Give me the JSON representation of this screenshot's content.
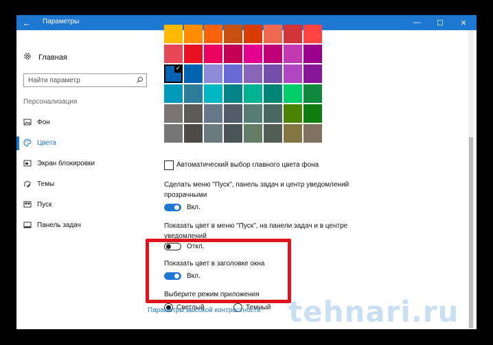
{
  "titlebar": {
    "title": "Параметры",
    "back_icon": "←",
    "min_icon": "—",
    "max_icon": "☐",
    "close_icon": "✕"
  },
  "sidebar": {
    "home": "Главная",
    "search_placeholder": "Найти параметр",
    "section": "Персонализация",
    "items": [
      {
        "label": "Фон",
        "icon": "image-icon"
      },
      {
        "label": "Цвета",
        "icon": "palette-icon",
        "active": true
      },
      {
        "label": "Экран блокировки",
        "icon": "lockscreen-icon"
      },
      {
        "label": "Темы",
        "icon": "themes-icon"
      },
      {
        "label": "Пуск",
        "icon": "start-icon"
      },
      {
        "label": "Панель задач",
        "icon": "taskbar-icon"
      }
    ]
  },
  "colors": {
    "rows": [
      [
        "#ffb900",
        "#ff8c00",
        "#f7630c",
        "#ca5010",
        "#da3b01",
        "#ef6950",
        "#d13438",
        "#ff4343"
      ],
      [
        "#e74856",
        "#e81123",
        "#ea005e",
        "#c30052",
        "#e3008c",
        "#bf0077",
        "#c239b3",
        "#9a0089"
      ],
      [
        "#0063b1",
        "#0063b1",
        "#8e8cd8",
        "#6b69d6",
        "#8764b8",
        "#744da9",
        "#b146c2",
        "#881798"
      ],
      [
        "#0099bc",
        "#2d7d9a",
        "#00b7c3",
        "#038387",
        "#00b294",
        "#018574",
        "#00cc6a",
        "#10893e"
      ],
      [
        "#7a7574",
        "#5d5a58",
        "#68768a",
        "#515c6b",
        "#567c73",
        "#486860",
        "#498205",
        "#107c10"
      ],
      [
        "#767676",
        "#4c4a48",
        "#69797e",
        "#4a5459",
        "#647c64",
        "#525e54",
        "#847545",
        "#7e735f"
      ]
    ],
    "selected_row": 2,
    "selected_col": 0,
    "accent": "#1e78d2",
    "highlight": "#e0121b"
  },
  "settings": {
    "auto_color_label": "Автоматический выбор главного цвета фона",
    "transparency_label": "Сделать меню \"Пуск\", панель задач и центр уведомлений прозрачными",
    "transparency_state": "Вкл.",
    "show_color_start_label": "Показать цвет в меню \"Пуск\", на панели задач и в центре уведомлений",
    "show_color_start_state": "Откл.",
    "title_bar_color_label": "Показать цвет в заголовке окна",
    "title_bar_color_state": "Вкл.",
    "app_mode_label": "Выберите режим приложения",
    "light": "Светлый",
    "dark": "Темный",
    "high_contrast_link": "Параметры высокой контрастности"
  },
  "watermark": "tehnari.ru"
}
